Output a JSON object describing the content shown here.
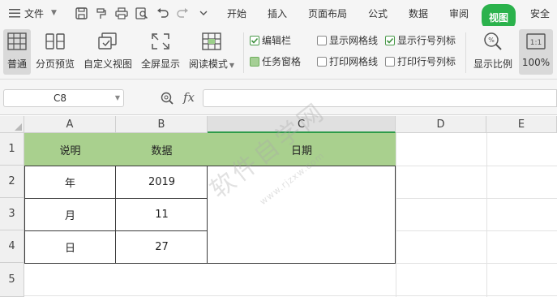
{
  "menubar": {
    "file_label": "文件",
    "tabs": [
      "开始",
      "插入",
      "页面布局",
      "公式",
      "数据",
      "审阅",
      "视图",
      "安全"
    ],
    "active_tab": "视图"
  },
  "ribbon": {
    "buttons": [
      {
        "label": "普通",
        "icon": "normal-view-icon"
      },
      {
        "label": "分页预览",
        "icon": "page-break-preview-icon"
      },
      {
        "label": "自定义视图",
        "icon": "custom-view-icon"
      },
      {
        "label": "全屏显示",
        "icon": "fullscreen-icon"
      },
      {
        "label": "阅读模式",
        "icon": "reading-mode-icon"
      },
      {
        "label": "显示比例",
        "icon": "zoom-ratio-icon"
      },
      {
        "label": "100%",
        "icon": "zoom-100-icon"
      }
    ],
    "checkboxes": [
      {
        "label": "编辑栏",
        "checked": true
      },
      {
        "label": "任务窗格",
        "checked": true
      },
      {
        "label": "显示网格线",
        "checked": false
      },
      {
        "label": "打印网格线",
        "checked": false
      },
      {
        "label": "显示行号列标",
        "checked": true
      },
      {
        "label": "打印行号列标",
        "checked": false
      }
    ]
  },
  "formula_bar": {
    "cell_ref": "C8",
    "fx_label": "fx",
    "formula_value": ""
  },
  "sheet": {
    "columns": [
      "A",
      "B",
      "C",
      "D",
      "E"
    ],
    "rows": [
      "1",
      "2",
      "3",
      "4",
      "5"
    ],
    "header_row": [
      "说明",
      "数据",
      "日期"
    ],
    "data_rows": [
      [
        "年",
        "2019"
      ],
      [
        "月",
        "11"
      ],
      [
        "日",
        "27"
      ]
    ],
    "header_fill_color": "#a9d08e",
    "selected_column": "C"
  },
  "watermark": {
    "text": "软件自学网",
    "subtext": "www.rjzxw.com"
  },
  "colors": {
    "accent_green": "#2bb24c",
    "column_select_green": "#2e9b4a"
  }
}
